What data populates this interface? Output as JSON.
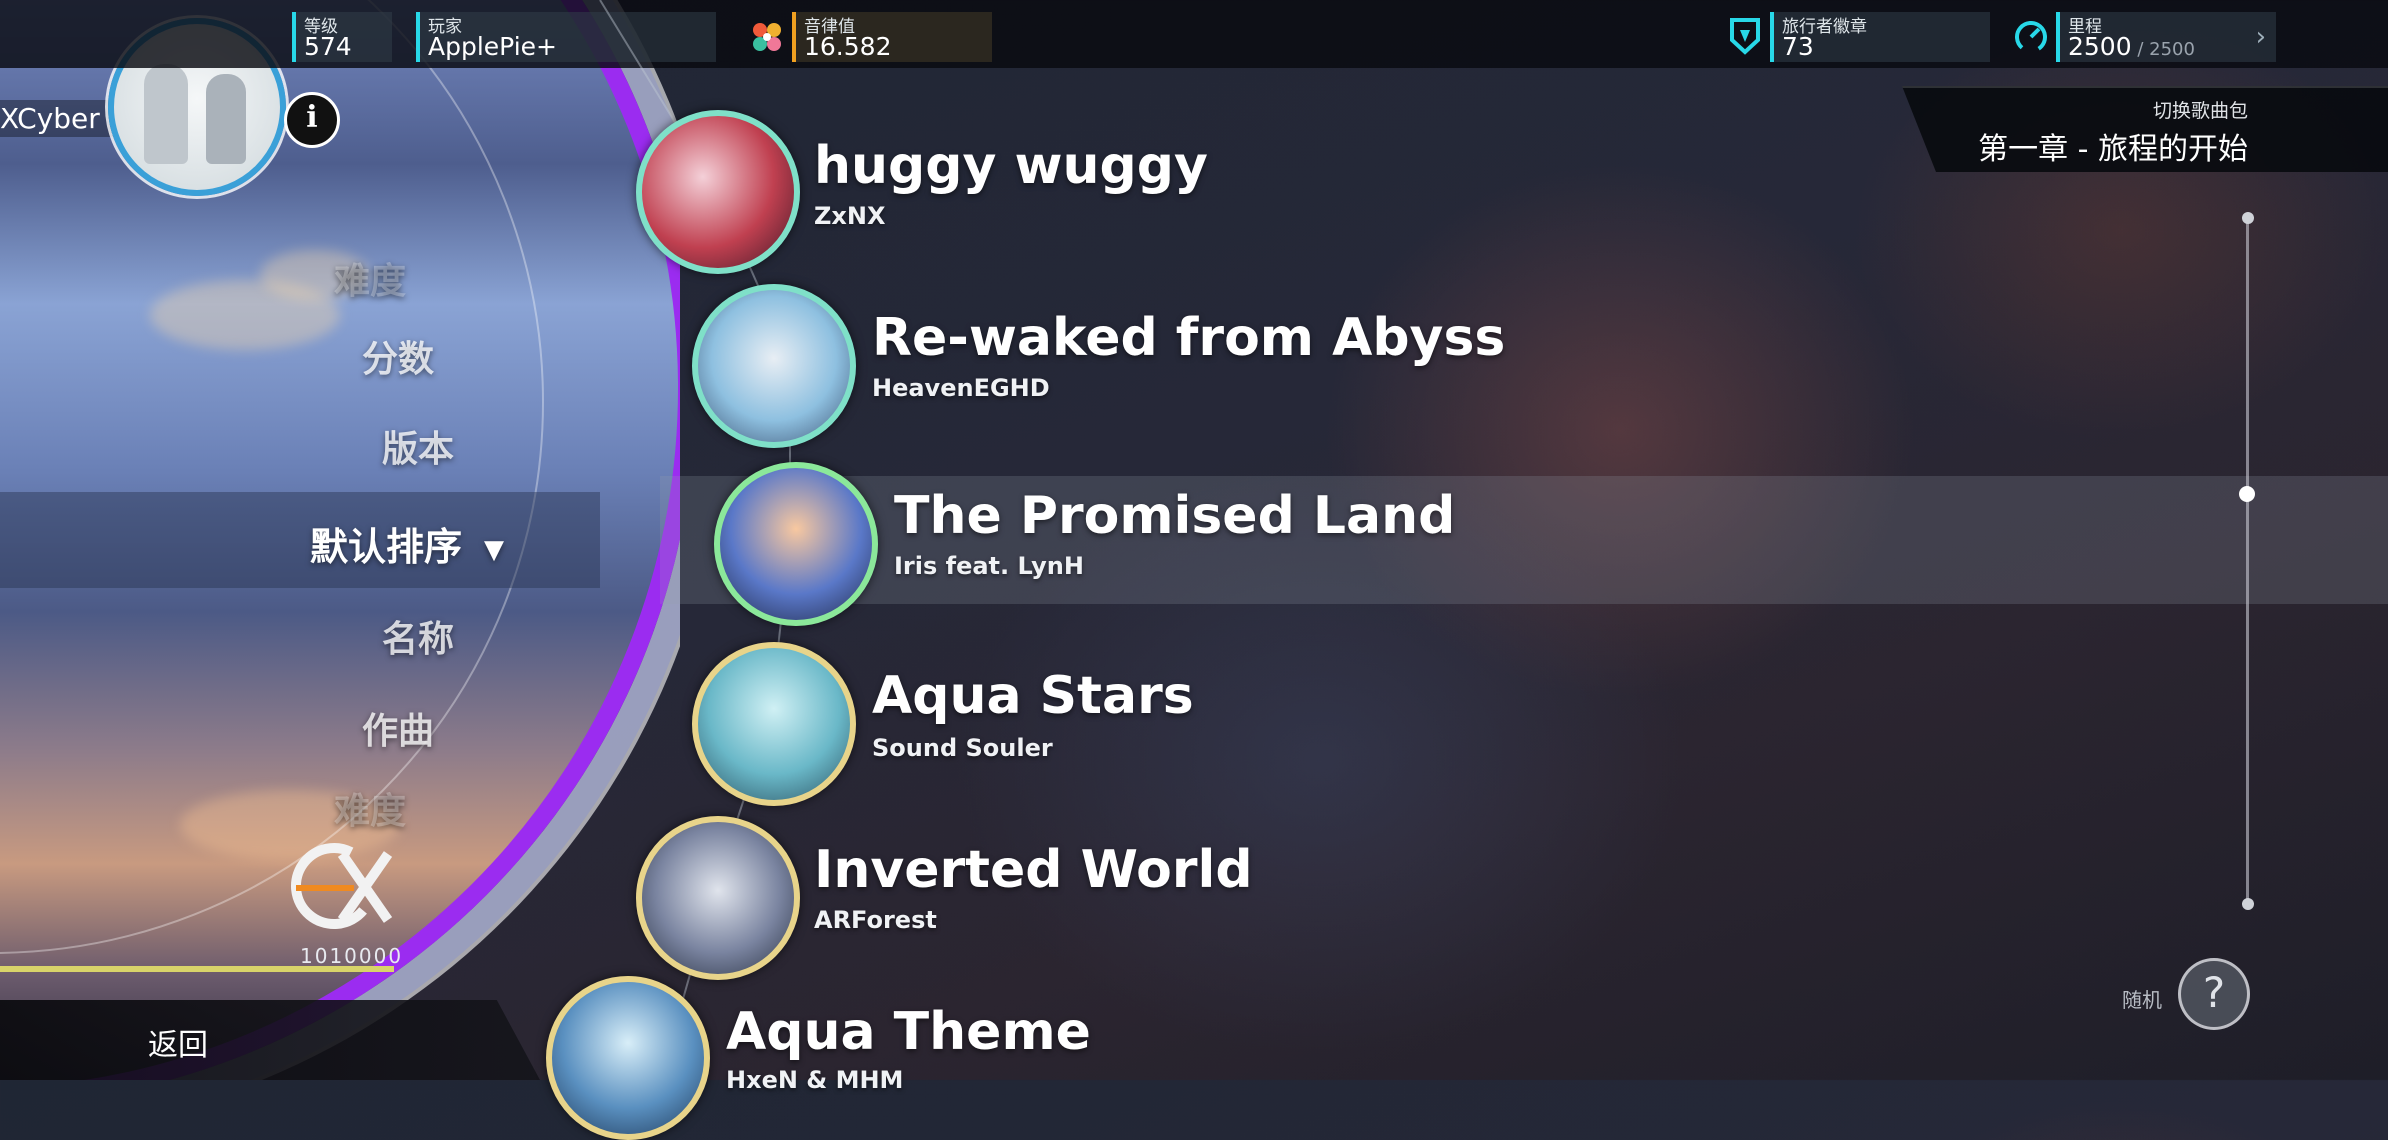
{
  "topbar": {
    "level": {
      "label": "等级",
      "value": "574"
    },
    "player": {
      "label": "玩家",
      "value": "ApplePie+"
    },
    "rhythm": {
      "label": "音律值",
      "value": "16.582",
      "icon": "rhythm-flower-icon"
    },
    "badges": {
      "label": "旅行者徽章",
      "value": "73",
      "icon": "traveler-badge-icon"
    },
    "mileage": {
      "label": "里程",
      "value": "2500",
      "max": " / 2500",
      "icon": "speedometer-icon"
    }
  },
  "profile": {
    "name_fragment": "XCyber | ",
    "info_icon": "i"
  },
  "sort_menu": {
    "items": [
      {
        "label": "难度",
        "state": "faded"
      },
      {
        "label": "分数",
        "state": "normal"
      },
      {
        "label": "版本",
        "state": "normal"
      },
      {
        "label": "默认排序",
        "state": "active"
      },
      {
        "label": "名称",
        "state": "normal"
      },
      {
        "label": "作曲",
        "state": "normal"
      },
      {
        "label": "难度",
        "state": "faded"
      }
    ],
    "active_indicator": "▼"
  },
  "score": {
    "value": "1010000",
    "logo": "ex-rank-icon"
  },
  "back_button": {
    "label": "返回"
  },
  "pack": {
    "switch_label": "切换歌曲包",
    "current": "第一章 - 旅程的开始"
  },
  "random": {
    "label": "随机",
    "icon": "?"
  },
  "songs": [
    {
      "title": "huggy wuggy",
      "artist": "ZxNX",
      "ring": "#7fe0c8"
    },
    {
      "title": "Re-waked from Abyss",
      "artist": "HeavenEGHD",
      "ring": "#7fe0c8"
    },
    {
      "title": "The Promised Land",
      "artist": "Iris feat. LynH",
      "ring": "#8be89a",
      "selected": true
    },
    {
      "title": "Aqua Stars",
      "artist": "Sound Souler",
      "ring": "#e8d48a"
    },
    {
      "title": "Inverted World",
      "artist": "ARForest",
      "ring": "#e8d48a"
    },
    {
      "title": "Aqua Theme",
      "artist": "HxeN & MHM",
      "ring": "#e8d48a"
    }
  ],
  "colors": {
    "accent_cyan": "#28d8e8",
    "accent_purple": "#9b2cf0",
    "accent_orange": "#f0a020"
  }
}
